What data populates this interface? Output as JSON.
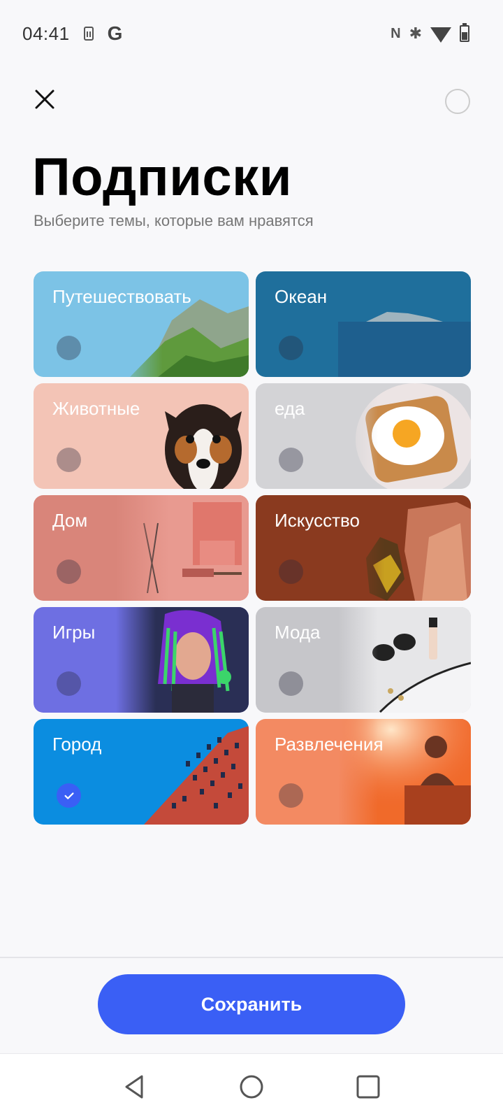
{
  "status_bar": {
    "time": "04:41",
    "icons": [
      "sim-card-icon",
      "google-icon",
      "nfc-icon",
      "bluetooth-icon",
      "wifi-icon",
      "battery-icon"
    ]
  },
  "header": {
    "title": "Подписки",
    "subtitle": "Выберите темы, которые вам нравятся"
  },
  "topics": [
    {
      "label": "Путешествовать",
      "selected": false,
      "color": "#7cc3e6",
      "icon": "mountain-landscape-image"
    },
    {
      "label": "Океан",
      "selected": false,
      "color": "#1f6f9c",
      "icon": "ocean-island-image"
    },
    {
      "label": "Животные",
      "selected": false,
      "color": "#f3c4b6",
      "icon": "dog-image"
    },
    {
      "label": "еда",
      "selected": false,
      "color": "#d3d3d6",
      "icon": "fried-egg-toast-image"
    },
    {
      "label": "Дом",
      "selected": false,
      "color": "#d9857a",
      "icon": "interior-room-image"
    },
    {
      "label": "Искусство",
      "selected": false,
      "color": "#8a3a1f",
      "icon": "low-poly-jug-image"
    },
    {
      "label": "Игры",
      "selected": false,
      "color": "#6e6fe2",
      "icon": "game-character-image"
    },
    {
      "label": "Мода",
      "selected": false,
      "color": "#c6c6ca",
      "icon": "sunglasses-accessories-image"
    },
    {
      "label": "Город",
      "selected": true,
      "color": "#0b8de0",
      "icon": "city-building-image"
    },
    {
      "label": "Развлечения",
      "selected": false,
      "color": "#f38a62",
      "icon": "dj-concert-image"
    }
  ],
  "actions": {
    "save_label": "Сохранить",
    "accent": "#3a5ff5"
  },
  "nav": [
    "back-icon",
    "home-icon",
    "recents-icon"
  ]
}
